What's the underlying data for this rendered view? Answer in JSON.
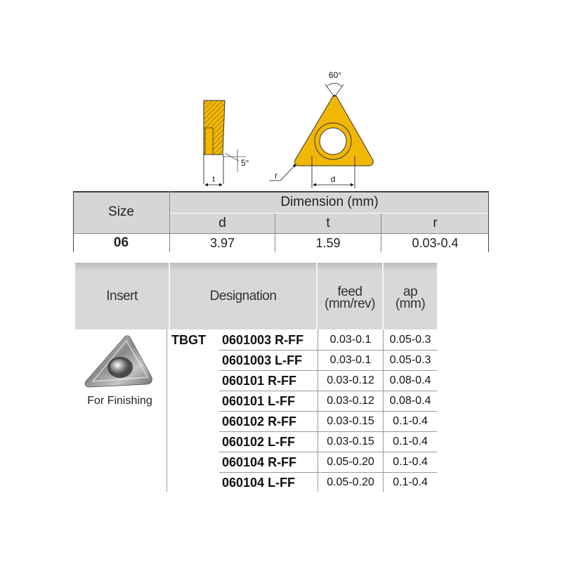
{
  "drawing": {
    "angle_label": "60°",
    "clearance_label": "5°",
    "t_label": "t",
    "d_label": "d",
    "r_label": "r",
    "insert_color": "#f2b705"
  },
  "dimension_table": {
    "size_header": "Size",
    "dimension_header": "Dimension (mm)",
    "col_d": "d",
    "col_t": "t",
    "col_r": "r",
    "size_value": "06",
    "d_value": "3.97",
    "t_value": "1.59",
    "r_value": "0.03-0.4"
  },
  "designation_table": {
    "insert_header": "Insert",
    "designation_header": "Designation",
    "feed_header_1": "feed",
    "feed_header_2": "(mm/rev)",
    "ap_header_1": "ap",
    "ap_header_2": "(mm)",
    "family": "TBGT",
    "insert_caption": "For Finishing",
    "rows": [
      {
        "code": "0601003 R-FF",
        "feed": "0.03-0.1",
        "ap": "0.05-0.3"
      },
      {
        "code": "0601003 L-FF",
        "feed": "0.03-0.1",
        "ap": "0.05-0.3"
      },
      {
        "code": "060101 R-FF",
        "feed": "0.03-0.12",
        "ap": "0.08-0.4"
      },
      {
        "code": "060101 L-FF",
        "feed": "0.03-0.12",
        "ap": "0.08-0.4"
      },
      {
        "code": "060102 R-FF",
        "feed": "0.03-0.15",
        "ap": "0.1-0.4"
      },
      {
        "code": "060102 L-FF",
        "feed": "0.03-0.15",
        "ap": "0.1-0.4"
      },
      {
        "code": "060104 R-FF",
        "feed": "0.05-0.20",
        "ap": "0.1-0.4"
      },
      {
        "code": "060104 L-FF",
        "feed": "0.05-0.20",
        "ap": "0.1-0.4"
      }
    ]
  }
}
